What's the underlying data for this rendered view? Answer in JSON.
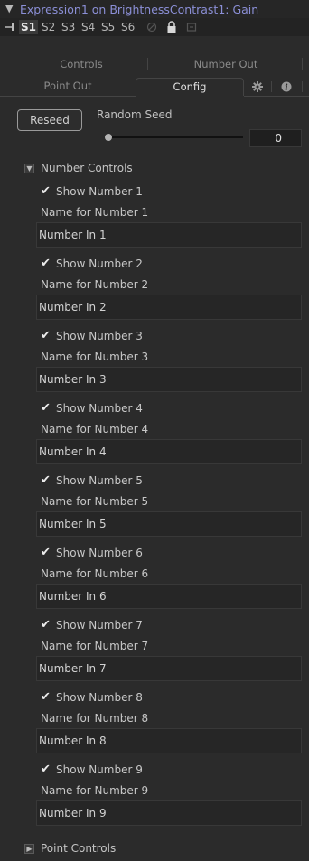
{
  "header": {
    "title": "Expression1 on BrightnessContrast1: Gain"
  },
  "subsets": [
    "S1",
    "S2",
    "S3",
    "S4",
    "S5",
    "S6"
  ],
  "tabs_row1": [
    "Controls",
    "Number Out"
  ],
  "tabs_row2": [
    "Point Out",
    "Config"
  ],
  "active_tab": "Config",
  "reseed": {
    "button": "Reseed",
    "label": "Random Seed",
    "value": "0"
  },
  "number_controls": {
    "label": "Number Controls",
    "items": [
      {
        "show": "Show Number 1",
        "name_label": "Name for Number 1",
        "name_value": "Number In 1"
      },
      {
        "show": "Show Number 2",
        "name_label": "Name for Number 2",
        "name_value": "Number In 2"
      },
      {
        "show": "Show Number 3",
        "name_label": "Name for Number 3",
        "name_value": "Number In 3"
      },
      {
        "show": "Show Number 4",
        "name_label": "Name for Number 4",
        "name_value": "Number In 4"
      },
      {
        "show": "Show Number 5",
        "name_label": "Name for Number 5",
        "name_value": "Number In 5"
      },
      {
        "show": "Show Number 6",
        "name_label": "Name for Number 6",
        "name_value": "Number In 6"
      },
      {
        "show": "Show Number 7",
        "name_label": "Name for Number 7",
        "name_value": "Number In 7"
      },
      {
        "show": "Show Number 8",
        "name_label": "Name for Number 8",
        "name_value": "Number In 8"
      },
      {
        "show": "Show Number 9",
        "name_label": "Name for Number 9",
        "name_value": "Number In 9"
      }
    ]
  },
  "point_controls": {
    "label": "Point Controls"
  },
  "icons": {
    "collapse": "chevron-down-icon",
    "pin": "pin-icon",
    "disable": "disable-icon",
    "lock": "lock-icon",
    "reset": "reset-icon",
    "settings": "gear-icon",
    "info": "info-icon"
  },
  "colors": {
    "title": "#8b8fd6",
    "background": "#2b2b2b"
  }
}
